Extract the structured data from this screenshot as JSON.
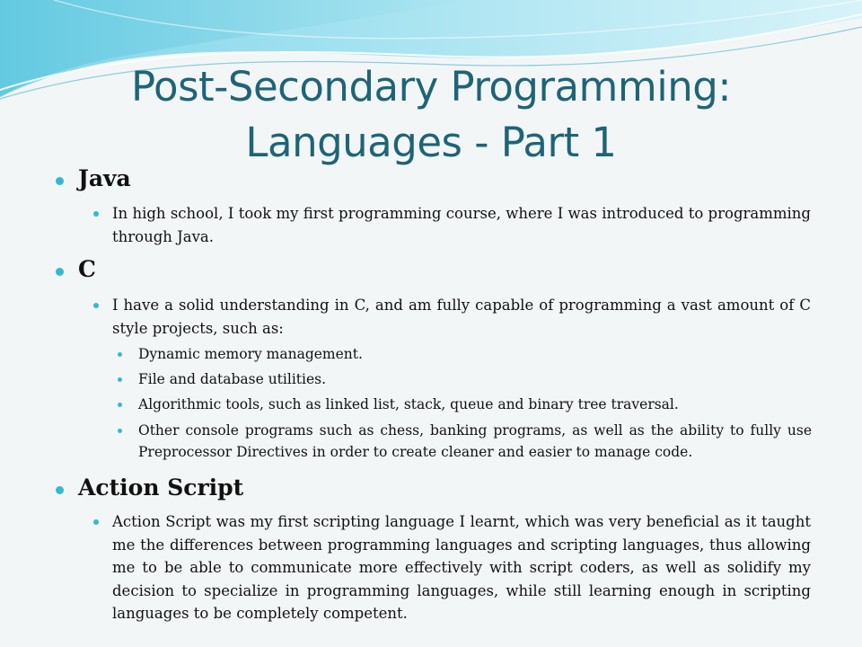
{
  "title": {
    "line1": "Post-Secondary Programming:",
    "line2": "Languages - Part 1"
  },
  "sections": [
    {
      "heading": "Java",
      "paragraphs": [
        "In high school, I took my first programming course, where I was introduced to programming through Java."
      ]
    },
    {
      "heading": "C",
      "paragraphs": [
        "I have a solid understanding in C, and am fully capable of programming a vast amount of C style projects, such as:"
      ],
      "sub_items": [
        "Dynamic memory management.",
        "File and database utilities.",
        "Algorithmic tools, such as linked list, stack, queue and binary tree traversal.",
        "Other console programs such as chess, banking programs, as well as the ability to fully use Preprocessor Directives in order to create cleaner and easier to manage code."
      ]
    },
    {
      "heading": "Action Script",
      "paragraphs": [
        "Action Script was my first scripting language I learnt, which was very beneficial as it taught me the differences between programming languages and scripting languages, thus allowing me to be able to communicate more effectively with script coders, as well as solidify my decision to specialize in programming languages, while still learning enough in scripting languages to be completely competent."
      ]
    }
  ],
  "colors": {
    "title": "#1e6477",
    "bullet": "#31b9d4",
    "wave_light": "#bfeaf4",
    "wave_mid": "#7fd2e6",
    "wave_dark": "#3fb5cf"
  }
}
